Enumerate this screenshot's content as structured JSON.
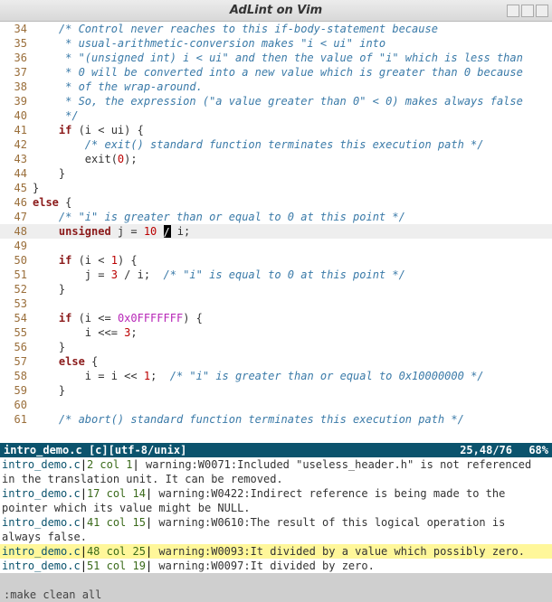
{
  "window": {
    "title": "AdLint on Vim"
  },
  "code_lines": [
    {
      "n": 34,
      "segs": [
        [
          "    ",
          ""
        ],
        [
          "/* Control never reaches to this if-body-statement because",
          "cm"
        ]
      ]
    },
    {
      "n": 35,
      "segs": [
        [
          "     ",
          ""
        ],
        [
          "* usual-arithmetic-conversion makes \"i < ui\" into",
          "cm"
        ]
      ]
    },
    {
      "n": 36,
      "segs": [
        [
          "     ",
          ""
        ],
        [
          "* \"(unsigned int) i < ui\" and then the value of \"i\" which is less than",
          "cm"
        ]
      ]
    },
    {
      "n": 37,
      "segs": [
        [
          "     ",
          ""
        ],
        [
          "* 0 will be converted into a new value which is greater than 0 because",
          "cm"
        ]
      ]
    },
    {
      "n": 38,
      "segs": [
        [
          "     ",
          ""
        ],
        [
          "* of the wrap-around.",
          "cm"
        ]
      ]
    },
    {
      "n": 39,
      "segs": [
        [
          "     ",
          ""
        ],
        [
          "* So, the expression (\"a value greater than 0\" < 0) makes always false",
          "cm"
        ]
      ]
    },
    {
      "n": 40,
      "segs": [
        [
          "     ",
          ""
        ],
        [
          "*/",
          "cm"
        ]
      ]
    },
    {
      "n": 41,
      "segs": [
        [
          "    ",
          ""
        ],
        [
          "if",
          "kw"
        ],
        [
          " (i < ui) {",
          ""
        ]
      ]
    },
    {
      "n": 42,
      "segs": [
        [
          "        ",
          ""
        ],
        [
          "/* exit() standard function terminates this execution path */",
          "cm"
        ]
      ]
    },
    {
      "n": 43,
      "segs": [
        [
          "        exit(",
          ""
        ],
        [
          "0",
          "num"
        ],
        [
          ");",
          ""
        ]
      ]
    },
    {
      "n": 44,
      "segs": [
        [
          "    }",
          ""
        ]
      ]
    },
    {
      "n": 45,
      "segs": [
        [
          "}",
          ""
        ]
      ]
    },
    {
      "n": 46,
      "segs": [
        [
          "else",
          "kw"
        ],
        [
          " {",
          ""
        ]
      ]
    },
    {
      "n": 47,
      "segs": [
        [
          "    ",
          ""
        ],
        [
          "/* \"i\" is greater than or equal to 0 at this point */",
          "cm"
        ]
      ]
    },
    {
      "n": 48,
      "hl": true,
      "cursor_at": 3,
      "segs": [
        [
          "    ",
          ""
        ],
        [
          "unsigned",
          "kw"
        ],
        [
          " j = ",
          ""
        ],
        [
          "10",
          "num"
        ],
        [
          " ",
          ""
        ],
        [
          "/",
          ""
        ],
        [
          " i;",
          ""
        ]
      ]
    },
    {
      "n": 49,
      "segs": [
        [
          "",
          ""
        ]
      ]
    },
    {
      "n": 50,
      "segs": [
        [
          "    ",
          ""
        ],
        [
          "if",
          "kw"
        ],
        [
          " (i < ",
          ""
        ],
        [
          "1",
          "num"
        ],
        [
          ") {",
          ""
        ]
      ]
    },
    {
      "n": 51,
      "segs": [
        [
          "        j = ",
          ""
        ],
        [
          "3",
          "num"
        ],
        [
          " / i;  ",
          ""
        ],
        [
          "/* \"i\" is equal to 0 at this point */",
          "cm"
        ]
      ]
    },
    {
      "n": 52,
      "segs": [
        [
          "    }",
          ""
        ]
      ]
    },
    {
      "n": 53,
      "segs": [
        [
          "",
          ""
        ]
      ]
    },
    {
      "n": 54,
      "segs": [
        [
          "    ",
          ""
        ],
        [
          "if",
          "kw"
        ],
        [
          " (i <= ",
          ""
        ],
        [
          "0x0FFFFFFF",
          "hex"
        ],
        [
          ") {",
          ""
        ]
      ]
    },
    {
      "n": 55,
      "segs": [
        [
          "        i <<= ",
          ""
        ],
        [
          "3",
          "num"
        ],
        [
          ";",
          ""
        ]
      ]
    },
    {
      "n": 56,
      "segs": [
        [
          "    }",
          ""
        ]
      ]
    },
    {
      "n": 57,
      "segs": [
        [
          "    ",
          ""
        ],
        [
          "else",
          "kw"
        ],
        [
          " {",
          ""
        ]
      ]
    },
    {
      "n": 58,
      "segs": [
        [
          "        i = i << ",
          ""
        ],
        [
          "1",
          "num"
        ],
        [
          ";  ",
          ""
        ],
        [
          "/* \"i\" is greater than or equal to 0x10000000 */",
          "cm"
        ]
      ]
    },
    {
      "n": 59,
      "segs": [
        [
          "    }",
          ""
        ]
      ]
    },
    {
      "n": 60,
      "segs": [
        [
          "",
          ""
        ]
      ]
    },
    {
      "n": 61,
      "segs": [
        [
          "    ",
          ""
        ],
        [
          "/* abort() standard function terminates this execution path */",
          "cm"
        ]
      ]
    }
  ],
  "status": {
    "file": "intro_demo.c",
    "flags": "[c][utf-8/unix]",
    "pos": "25,48/76",
    "pct": "68%"
  },
  "quickfix": [
    {
      "file": "intro_demo.c",
      "pos": "2 col 1",
      "msg": "warning:W0071:Included \"useless_header.h\" is not referenced in the translation unit. It can be removed."
    },
    {
      "file": "intro_demo.c",
      "pos": "17 col 14",
      "msg": "warning:W0422:Indirect reference is being made to the pointer which its value might be NULL."
    },
    {
      "file": "intro_demo.c",
      "pos": "41 col 15",
      "msg": "warning:W0610:The result of this logical operation is always false."
    },
    {
      "file": "intro_demo.c",
      "pos": "48 col 25",
      "msg": "warning:W0093:It divided by a value which possibly zero.",
      "hl": true
    },
    {
      "file": "intro_demo.c",
      "pos": "51 col 19",
      "msg": "warning:W0097:It divided by zero."
    }
  ],
  "cmdline": ":make clean all"
}
